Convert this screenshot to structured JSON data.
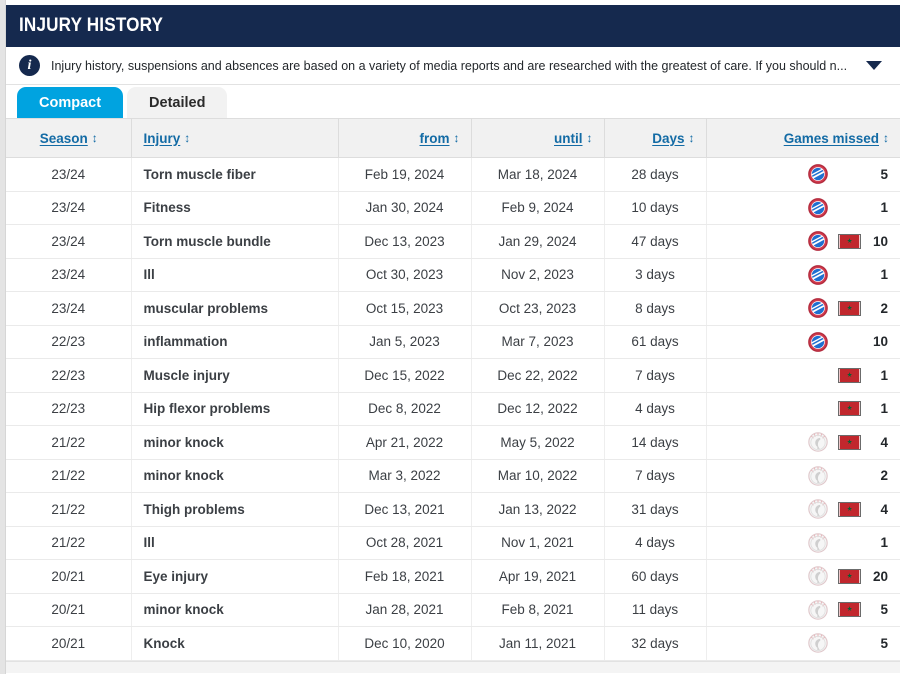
{
  "header": {
    "title": "INJURY HISTORY"
  },
  "info": {
    "icon": "info-icon",
    "text": "Injury history, suspensions and absences are based on a variety of media reports and are researched with the greatest of care. If you should n...",
    "caret": "chevron-down-icon"
  },
  "tabs": [
    {
      "label": "Compact",
      "active": true
    },
    {
      "label": "Detailed",
      "active": false
    }
  ],
  "table": {
    "sort_glyph": "↕",
    "columns": [
      {
        "key": "season",
        "label": "Season",
        "align": "center"
      },
      {
        "key": "injury",
        "label": "Injury",
        "align": "left"
      },
      {
        "key": "from",
        "label": "from",
        "align": "center"
      },
      {
        "key": "until",
        "label": "until",
        "align": "center"
      },
      {
        "key": "days",
        "label": "Days",
        "align": "center"
      },
      {
        "key": "games",
        "label": "Games missed",
        "align": "right"
      }
    ],
    "rows": [
      {
        "season": "23/24",
        "injury": "Torn muscle fiber",
        "from": "Feb 19, 2024",
        "until": "Mar 18, 2024",
        "days": "28 days",
        "crest": "espanyol-crest",
        "flag": "",
        "games": "5"
      },
      {
        "season": "23/24",
        "injury": "Fitness",
        "from": "Jan 30, 2024",
        "until": "Feb 9, 2024",
        "days": "10 days",
        "crest": "espanyol-crest",
        "flag": "",
        "games": "1"
      },
      {
        "season": "23/24",
        "injury": "Torn muscle bundle",
        "from": "Dec 13, 2023",
        "until": "Jan 29, 2024",
        "days": "47 days",
        "crest": "espanyol-crest",
        "flag": "morocco-flag",
        "games": "10"
      },
      {
        "season": "23/24",
        "injury": "Ill",
        "from": "Oct 30, 2023",
        "until": "Nov 2, 2023",
        "days": "3 days",
        "crest": "espanyol-crest",
        "flag": "",
        "games": "1"
      },
      {
        "season": "23/24",
        "injury": "muscular problems",
        "from": "Oct 15, 2023",
        "until": "Oct 23, 2023",
        "days": "8 days",
        "crest": "espanyol-crest",
        "flag": "morocco-flag",
        "games": "2"
      },
      {
        "season": "22/23",
        "injury": "inflammation",
        "from": "Jan 5, 2023",
        "until": "Mar 7, 2023",
        "days": "61 days",
        "crest": "espanyol-crest",
        "flag": "",
        "games": "10"
      },
      {
        "season": "22/23",
        "injury": "Muscle injury",
        "from": "Dec 15, 2022",
        "until": "Dec 22, 2022",
        "days": "7 days",
        "crest": "",
        "flag": "morocco-flag",
        "games": "1"
      },
      {
        "season": "22/23",
        "injury": "Hip flexor problems",
        "from": "Dec 8, 2022",
        "until": "Dec 12, 2022",
        "days": "4 days",
        "crest": "",
        "flag": "morocco-flag",
        "games": "1"
      },
      {
        "season": "21/22",
        "injury": "minor knock",
        "from": "Apr 21, 2022",
        "until": "May 5, 2022",
        "days": "14 days",
        "crest": "ajax-crest",
        "flag": "morocco-flag",
        "games": "4"
      },
      {
        "season": "21/22",
        "injury": "minor knock",
        "from": "Mar 3, 2022",
        "until": "Mar 10, 2022",
        "days": "7 days",
        "crest": "ajax-crest",
        "flag": "",
        "games": "2"
      },
      {
        "season": "21/22",
        "injury": "Thigh problems",
        "from": "Dec 13, 2021",
        "until": "Jan 13, 2022",
        "days": "31 days",
        "crest": "ajax-crest",
        "flag": "morocco-flag",
        "games": "4"
      },
      {
        "season": "21/22",
        "injury": "Ill",
        "from": "Oct 28, 2021",
        "until": "Nov 1, 2021",
        "days": "4 days",
        "crest": "ajax-crest",
        "flag": "",
        "games": "1"
      },
      {
        "season": "20/21",
        "injury": "Eye injury",
        "from": "Feb 18, 2021",
        "until": "Apr 19, 2021",
        "days": "60 days",
        "crest": "ajax-crest",
        "flag": "morocco-flag",
        "games": "20"
      },
      {
        "season": "20/21",
        "injury": "minor knock",
        "from": "Jan 28, 2021",
        "until": "Feb 8, 2021",
        "days": "11 days",
        "crest": "ajax-crest",
        "flag": "morocco-flag",
        "games": "5"
      },
      {
        "season": "20/21",
        "injury": "Knock",
        "from": "Dec 10, 2020",
        "until": "Jan 11, 2021",
        "days": "32 days",
        "crest": "ajax-crest",
        "flag": "",
        "games": "5"
      }
    ]
  },
  "colors": {
    "header_navy": "#15294e",
    "tab_active": "#00a3e0",
    "link_blue": "#136ba5",
    "flag_red": "#c1272d",
    "flag_green": "#006233"
  }
}
